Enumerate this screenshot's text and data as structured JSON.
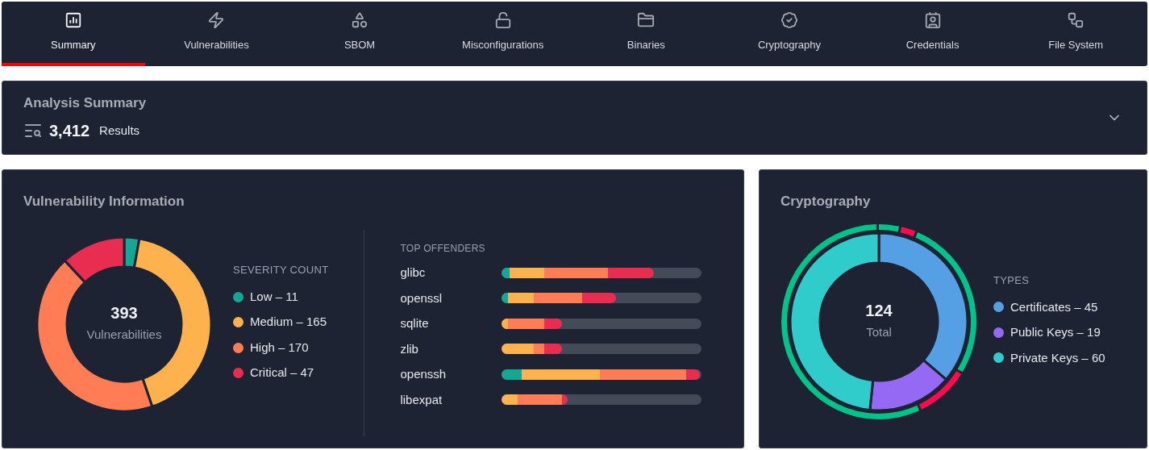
{
  "tabs": [
    {
      "label": "Summary",
      "selected": true
    },
    {
      "label": "Vulnerabilities",
      "selected": false
    },
    {
      "label": "SBOM",
      "selected": false
    },
    {
      "label": "Misconfigurations",
      "selected": false
    },
    {
      "label": "Binaries",
      "selected": false
    },
    {
      "label": "Cryptography",
      "selected": false
    },
    {
      "label": "Credentials",
      "selected": false
    },
    {
      "label": "File System",
      "selected": false
    }
  ],
  "summary": {
    "title": "Analysis Summary",
    "count": "3,412",
    "count_label": "Results",
    "expanded": false
  },
  "vulnerability": {
    "title": "Vulnerability Information",
    "total": "393",
    "total_label": "Vulnerabilities",
    "legend_title": "SEVERITY COUNT",
    "legend": [
      {
        "label": "Low – 11",
        "color": "#14a795"
      },
      {
        "label": "Medium – 165",
        "color": "#fdb24e"
      },
      {
        "label": "High – 170",
        "color": "#ff7c55"
      },
      {
        "label": "Critical – 47",
        "color": "#e82d50"
      }
    ],
    "chart_data": {
      "type": "donut",
      "series": [
        {
          "values": [
            2.8,
            41.98,
            43.26,
            11.96
          ]
        }
      ]
    },
    "offenders_title": "TOP OFFENDERS",
    "offenders": [
      {
        "name": "glibc",
        "segments": [
          {
            "kind": "low"
          },
          {
            "kind": "medium"
          },
          {
            "kind": "high"
          },
          {
            "kind": "critical"
          }
        ]
      },
      {
        "name": "openssl",
        "segments": [
          {
            "kind": "low"
          },
          {
            "kind": "medium"
          },
          {
            "kind": "high"
          },
          {
            "kind": "critical"
          }
        ]
      },
      {
        "name": "sqlite",
        "segments": [
          {
            "kind": "medium"
          },
          {
            "kind": "high"
          },
          {
            "kind": "critical"
          }
        ]
      },
      {
        "name": "zlib",
        "segments": [
          {
            "kind": "medium"
          },
          {
            "kind": "high"
          },
          {
            "kind": "critical"
          }
        ]
      },
      {
        "name": "openssh",
        "segments": [
          {
            "kind": "low"
          },
          {
            "kind": "medium"
          },
          {
            "kind": "high"
          },
          {
            "kind": "critical"
          }
        ]
      },
      {
        "name": "libexpat",
        "segments": [
          {
            "kind": "medium"
          },
          {
            "kind": "high"
          },
          {
            "kind": "critical"
          }
        ]
      }
    ]
  },
  "cryptography": {
    "title": "Cryptography",
    "total": "124",
    "total_label": "Total",
    "legend_title": "TYPES",
    "legend": [
      {
        "label": "Certificates – 45",
        "color": "#559fe4"
      },
      {
        "label": "Public Keys – 19",
        "color": "#9569f3"
      },
      {
        "label": "Private Keys – 60",
        "color": "#30cccc"
      }
    ],
    "chart_data": {
      "type": "donut",
      "series": [
        {
          "values": [
            36.29,
            15.32,
            48.39
          ]
        }
      ]
    }
  }
}
